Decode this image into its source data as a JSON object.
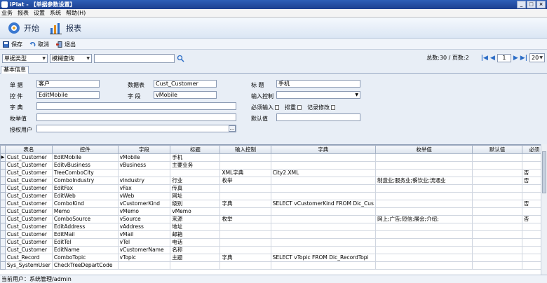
{
  "window": {
    "title": "iPlat - 【单据参数设置】",
    "min": "_",
    "max": "□",
    "close": "×"
  },
  "menu": [
    "业务",
    "报表",
    "设置",
    "系统",
    "帮助(H)"
  ],
  "bigtoolbar": {
    "start_label": "开始",
    "report_label": "报表"
  },
  "toolbar": {
    "save_label": "保存",
    "cancel_label": "取消",
    "exit_label": "退出"
  },
  "search": {
    "type_select": "单据类型",
    "mode_select": "模糊查询",
    "keyword": ""
  },
  "pager": {
    "summary": "总数:30 / 页数:2",
    "current_page": "1",
    "page_size": "20",
    "first": "|◀",
    "prev": "◀",
    "next": "▶",
    "last": "▶|"
  },
  "tab": {
    "label": "基本信息"
  },
  "form": {
    "danju_label": "单 据",
    "danju_value": "客户",
    "table_label": "数据表",
    "table_value": "Cust_Customer",
    "title_label": "标 题",
    "title_value": "手机",
    "control_label": "控 件",
    "control_value": "EditMobile",
    "field_label": "字 段",
    "field_value": "vMobile",
    "input_control_label": "输入控制",
    "input_control_value": "",
    "dict_label": "字 典",
    "dict_value": "",
    "required_label": "必须输入",
    "sort_label": "排重",
    "log_label": "记录修改",
    "enum_label": "枚举值",
    "enum_value": "",
    "default_label": "默认值",
    "default_value": "",
    "auth_label": "授权用户",
    "auth_value": "",
    "ellipsis": "..."
  },
  "grid": {
    "columns": [
      "表名",
      "控件",
      "字段",
      "标题",
      "输入控制",
      "字典",
      "枚举值",
      "默认值",
      "必须"
    ],
    "rows": [
      [
        "Cust_Customer",
        "EditMobile",
        "vMobile",
        "手机",
        "",
        "",
        "",
        "",
        ""
      ],
      [
        "Cust_Customer",
        "EditvBusiness",
        "vBusiness",
        "主要业务",
        "",
        "",
        "",
        "",
        ""
      ],
      [
        "Cust_Customer",
        "TreeComboCity",
        "",
        "",
        "XML字典",
        "City2.XML",
        "",
        "",
        "否"
      ],
      [
        "Cust_Customer",
        "ComboIndustry",
        "vIndustry",
        "行业",
        "枚举",
        "",
        "制造业;服务业;餐饮业;流通业",
        "",
        "否"
      ],
      [
        "Cust_Customer",
        "EditFax",
        "vFax",
        "传真",
        "",
        "",
        "",
        "",
        ""
      ],
      [
        "Cust_Customer",
        "EditWeb",
        "vWeb",
        "网址",
        "",
        "",
        "",
        "",
        ""
      ],
      [
        "Cust_Customer",
        "ComboKind",
        "vCustomerKind",
        "级别",
        "字典",
        "SELECT vCustomerKind FROM Dic_Cus",
        "",
        "",
        "否"
      ],
      [
        "Cust_Customer",
        "Memo",
        "vMemo",
        "vMemo",
        "",
        "",
        "",
        "",
        ""
      ],
      [
        "Cust_Customer",
        "ComboSource",
        "vSource",
        "来源",
        "枚举",
        "",
        "网上;广告;短信;展会;介绍;",
        "",
        "否"
      ],
      [
        "Cust_Customer",
        "EditAddress",
        "vAddress",
        "地址",
        "",
        "",
        "",
        "",
        ""
      ],
      [
        "Cust_Customer",
        "EditMail",
        "vMail",
        "邮箱",
        "",
        "",
        "",
        "",
        ""
      ],
      [
        "Cust_Customer",
        "EditTel",
        "vTel",
        "电话",
        "",
        "",
        "",
        "",
        ""
      ],
      [
        "Cust_Customer",
        "EditName",
        "vCustomerName",
        "名称",
        "",
        "",
        "",
        "",
        ""
      ],
      [
        "Cust_Record",
        "ComboTopic",
        "vTopic",
        "主题",
        "字典",
        "SELECT vTopic FROM Dic_RecordTopi",
        "",
        "",
        ""
      ],
      [
        "Sys_SystemUser",
        "CheckTreeDepartCode",
        "",
        "",
        "",
        "",
        "",
        "",
        ""
      ]
    ]
  },
  "status": {
    "text": "当前用户：系统管理/admin"
  }
}
